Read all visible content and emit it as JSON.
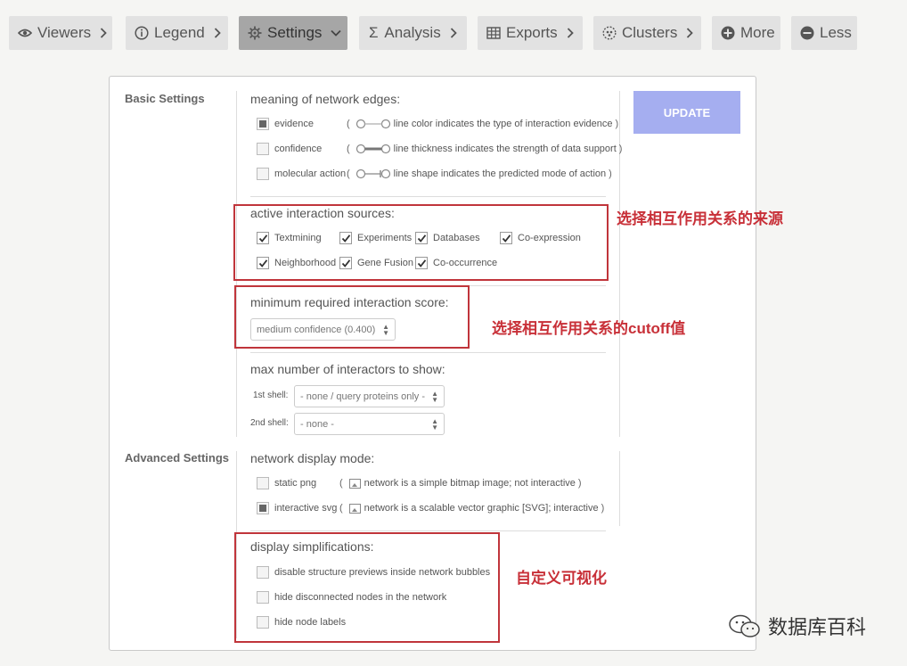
{
  "toolbar": {
    "viewers": "Viewers",
    "legend": "Legend",
    "settings": "Settings",
    "analysis": "Analysis",
    "exports": "Exports",
    "clusters": "Clusters",
    "more": "More",
    "less": "Less"
  },
  "basic": {
    "label": "Basic Settings",
    "edges_title": "meaning of network edges:",
    "edges": [
      {
        "label": "evidence",
        "hint": "line color indicates the type of interaction evidence",
        "selected": true
      },
      {
        "label": "confidence",
        "hint": "line thickness indicates the strength of data support",
        "selected": false
      },
      {
        "label": "molecular action",
        "hint": "line shape indicates the predicted mode of action",
        "selected": false
      }
    ],
    "sources_title": "active interaction sources:",
    "sources": [
      "Textmining",
      "Experiments",
      "Databases",
      "Co-expression",
      "Neighborhood",
      "Gene Fusion",
      "Co-occurrence"
    ],
    "score_title": "minimum required interaction score:",
    "score_value": "medium confidence (0.400)",
    "max_title": "max number of interactors to show:",
    "shell1_label": "1st shell:",
    "shell1_value": "- none / query proteins only -",
    "shell2_label": "2nd shell:",
    "shell2_value": "- none -"
  },
  "update_label": "UPDATE",
  "advanced": {
    "label": "Advanced Settings",
    "display_title": "network display mode:",
    "display": [
      {
        "label": "static png",
        "hint": "network is a simple bitmap image; not interactive",
        "selected": false
      },
      {
        "label": "interactive svg",
        "hint": "network is a scalable vector graphic [SVG]; interactive",
        "selected": true
      }
    ],
    "simp_title": "display simplifications:",
    "simplifications": [
      "disable structure previews inside network bubbles",
      "hide disconnected nodes in the network",
      "hide node labels"
    ]
  },
  "annotations": {
    "sources": "选择相互作用关系的来源",
    "score": "选择相互作用关系的cutoff值",
    "display": "自定义可视化"
  },
  "watermark": "数据库百科",
  "colors": {
    "accent": "#a5aef0",
    "annotation": "#c0353b",
    "active_tab": "#a6a6a6"
  }
}
